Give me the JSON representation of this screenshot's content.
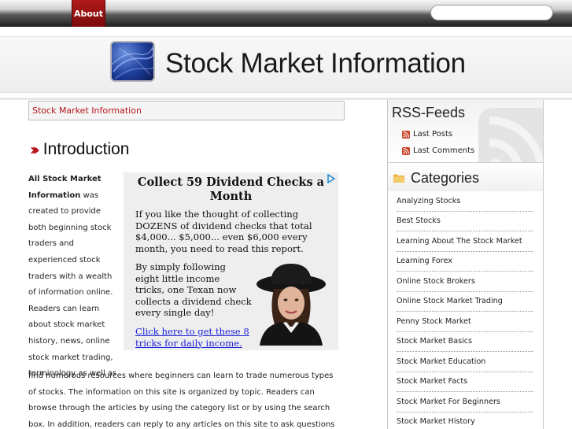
{
  "nav": {
    "about_label": "About"
  },
  "search": {
    "placeholder": ""
  },
  "header": {
    "site_title": "Stock Market Information"
  },
  "breadcrumb": {
    "current": "Stock Market Information"
  },
  "article": {
    "title": "Introduction",
    "intro_bold": "All Stock Market Information",
    "intro_rest": " was created to provide both beginning stock traders and experienced stock traders with a wealth of information online. Readers can learn about stock market history, news, online stock market trading, terminology as well as",
    "continued": "find numerous resources where beginners can learn to trade numerous types of stocks. The information on this site is organized by topic. Readers can browse through the articles by using the category list or by using the search box. In addition, readers can reply to any articles on this site to ask questions about the stock market. We will do our"
  },
  "ad": {
    "headline": "Collect 59 Dividend Checks a Month",
    "paragraph1": "If you like the thought of collecting DOZENS of dividend checks that total $4,000... $5,000... even $6,000 every month, you need to read this report.",
    "paragraph2": "By simply following eight little income tricks, one Texan now collects a dividend check every single day!",
    "link": "Click here to get these 8 tricks for daily income."
  },
  "sidebar": {
    "rss_title": "RSS-Feeds",
    "rss_links": [
      "Last Posts",
      "Last Comments"
    ],
    "categories_title": "Categories",
    "categories": [
      "Analyzing Stocks",
      "Best Stocks",
      "Learning About The Stock Market",
      "Learning Forex",
      "Online Stock Brokers",
      "Online Stock Market Trading",
      "Penny Stock Market",
      "Stock Market Basics",
      "Stock Market Education",
      "Stock Market Facts",
      "Stock Market For Beginners",
      "Stock Market History"
    ]
  },
  "colors": {
    "accent_red": "#b5141b",
    "nav_active": "#9a1212",
    "ad_link": "#1a20d8",
    "ad_background": "#eeeeee"
  },
  "icons": {
    "logo": "blue-square-logo",
    "title_marker": "double-chevron-right-icon",
    "rss": "rss-feed-icon",
    "categories": "folder-icon",
    "ad_choices": "ad-choices-icon"
  }
}
